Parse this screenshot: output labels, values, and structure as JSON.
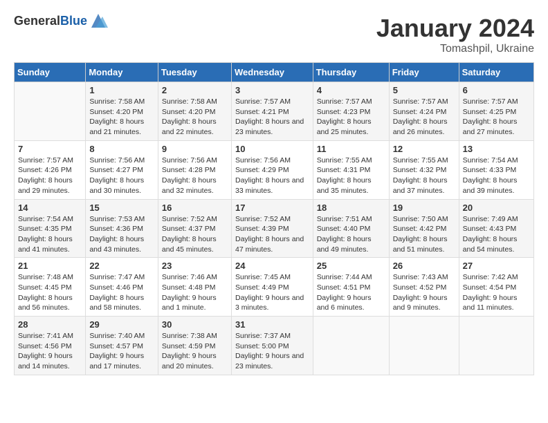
{
  "header": {
    "logo_general": "General",
    "logo_blue": "Blue",
    "month": "January 2024",
    "location": "Tomashpil, Ukraine"
  },
  "columns": [
    "Sunday",
    "Monday",
    "Tuesday",
    "Wednesday",
    "Thursday",
    "Friday",
    "Saturday"
  ],
  "weeks": [
    [
      {
        "day": "",
        "sunrise": "",
        "sunset": "",
        "daylight": ""
      },
      {
        "day": "1",
        "sunrise": "Sunrise: 7:58 AM",
        "sunset": "Sunset: 4:20 PM",
        "daylight": "Daylight: 8 hours and 21 minutes."
      },
      {
        "day": "2",
        "sunrise": "Sunrise: 7:58 AM",
        "sunset": "Sunset: 4:20 PM",
        "daylight": "Daylight: 8 hours and 22 minutes."
      },
      {
        "day": "3",
        "sunrise": "Sunrise: 7:57 AM",
        "sunset": "Sunset: 4:21 PM",
        "daylight": "Daylight: 8 hours and 23 minutes."
      },
      {
        "day": "4",
        "sunrise": "Sunrise: 7:57 AM",
        "sunset": "Sunset: 4:23 PM",
        "daylight": "Daylight: 8 hours and 25 minutes."
      },
      {
        "day": "5",
        "sunrise": "Sunrise: 7:57 AM",
        "sunset": "Sunset: 4:24 PM",
        "daylight": "Daylight: 8 hours and 26 minutes."
      },
      {
        "day": "6",
        "sunrise": "Sunrise: 7:57 AM",
        "sunset": "Sunset: 4:25 PM",
        "daylight": "Daylight: 8 hours and 27 minutes."
      }
    ],
    [
      {
        "day": "7",
        "sunrise": "Sunrise: 7:57 AM",
        "sunset": "Sunset: 4:26 PM",
        "daylight": "Daylight: 8 hours and 29 minutes."
      },
      {
        "day": "8",
        "sunrise": "Sunrise: 7:56 AM",
        "sunset": "Sunset: 4:27 PM",
        "daylight": "Daylight: 8 hours and 30 minutes."
      },
      {
        "day": "9",
        "sunrise": "Sunrise: 7:56 AM",
        "sunset": "Sunset: 4:28 PM",
        "daylight": "Daylight: 8 hours and 32 minutes."
      },
      {
        "day": "10",
        "sunrise": "Sunrise: 7:56 AM",
        "sunset": "Sunset: 4:29 PM",
        "daylight": "Daylight: 8 hours and 33 minutes."
      },
      {
        "day": "11",
        "sunrise": "Sunrise: 7:55 AM",
        "sunset": "Sunset: 4:31 PM",
        "daylight": "Daylight: 8 hours and 35 minutes."
      },
      {
        "day": "12",
        "sunrise": "Sunrise: 7:55 AM",
        "sunset": "Sunset: 4:32 PM",
        "daylight": "Daylight: 8 hours and 37 minutes."
      },
      {
        "day": "13",
        "sunrise": "Sunrise: 7:54 AM",
        "sunset": "Sunset: 4:33 PM",
        "daylight": "Daylight: 8 hours and 39 minutes."
      }
    ],
    [
      {
        "day": "14",
        "sunrise": "Sunrise: 7:54 AM",
        "sunset": "Sunset: 4:35 PM",
        "daylight": "Daylight: 8 hours and 41 minutes."
      },
      {
        "day": "15",
        "sunrise": "Sunrise: 7:53 AM",
        "sunset": "Sunset: 4:36 PM",
        "daylight": "Daylight: 8 hours and 43 minutes."
      },
      {
        "day": "16",
        "sunrise": "Sunrise: 7:52 AM",
        "sunset": "Sunset: 4:37 PM",
        "daylight": "Daylight: 8 hours and 45 minutes."
      },
      {
        "day": "17",
        "sunrise": "Sunrise: 7:52 AM",
        "sunset": "Sunset: 4:39 PM",
        "daylight": "Daylight: 8 hours and 47 minutes."
      },
      {
        "day": "18",
        "sunrise": "Sunrise: 7:51 AM",
        "sunset": "Sunset: 4:40 PM",
        "daylight": "Daylight: 8 hours and 49 minutes."
      },
      {
        "day": "19",
        "sunrise": "Sunrise: 7:50 AM",
        "sunset": "Sunset: 4:42 PM",
        "daylight": "Daylight: 8 hours and 51 minutes."
      },
      {
        "day": "20",
        "sunrise": "Sunrise: 7:49 AM",
        "sunset": "Sunset: 4:43 PM",
        "daylight": "Daylight: 8 hours and 54 minutes."
      }
    ],
    [
      {
        "day": "21",
        "sunrise": "Sunrise: 7:48 AM",
        "sunset": "Sunset: 4:45 PM",
        "daylight": "Daylight: 8 hours and 56 minutes."
      },
      {
        "day": "22",
        "sunrise": "Sunrise: 7:47 AM",
        "sunset": "Sunset: 4:46 PM",
        "daylight": "Daylight: 8 hours and 58 minutes."
      },
      {
        "day": "23",
        "sunrise": "Sunrise: 7:46 AM",
        "sunset": "Sunset: 4:48 PM",
        "daylight": "Daylight: 9 hours and 1 minute."
      },
      {
        "day": "24",
        "sunrise": "Sunrise: 7:45 AM",
        "sunset": "Sunset: 4:49 PM",
        "daylight": "Daylight: 9 hours and 3 minutes."
      },
      {
        "day": "25",
        "sunrise": "Sunrise: 7:44 AM",
        "sunset": "Sunset: 4:51 PM",
        "daylight": "Daylight: 9 hours and 6 minutes."
      },
      {
        "day": "26",
        "sunrise": "Sunrise: 7:43 AM",
        "sunset": "Sunset: 4:52 PM",
        "daylight": "Daylight: 9 hours and 9 minutes."
      },
      {
        "day": "27",
        "sunrise": "Sunrise: 7:42 AM",
        "sunset": "Sunset: 4:54 PM",
        "daylight": "Daylight: 9 hours and 11 minutes."
      }
    ],
    [
      {
        "day": "28",
        "sunrise": "Sunrise: 7:41 AM",
        "sunset": "Sunset: 4:56 PM",
        "daylight": "Daylight: 9 hours and 14 minutes."
      },
      {
        "day": "29",
        "sunrise": "Sunrise: 7:40 AM",
        "sunset": "Sunset: 4:57 PM",
        "daylight": "Daylight: 9 hours and 17 minutes."
      },
      {
        "day": "30",
        "sunrise": "Sunrise: 7:38 AM",
        "sunset": "Sunset: 4:59 PM",
        "daylight": "Daylight: 9 hours and 20 minutes."
      },
      {
        "day": "31",
        "sunrise": "Sunrise: 7:37 AM",
        "sunset": "Sunset: 5:00 PM",
        "daylight": "Daylight: 9 hours and 23 minutes."
      },
      {
        "day": "",
        "sunrise": "",
        "sunset": "",
        "daylight": ""
      },
      {
        "day": "",
        "sunrise": "",
        "sunset": "",
        "daylight": ""
      },
      {
        "day": "",
        "sunrise": "",
        "sunset": "",
        "daylight": ""
      }
    ]
  ]
}
